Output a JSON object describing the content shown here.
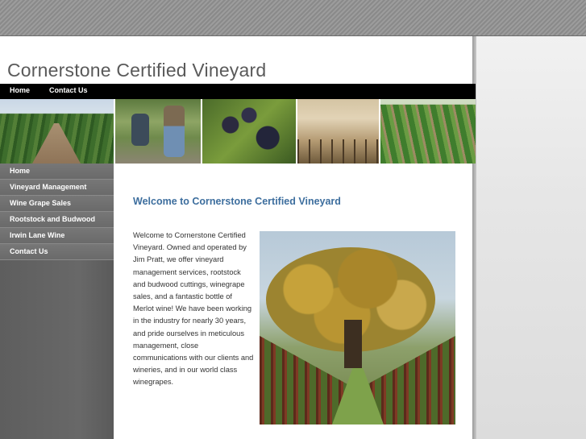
{
  "site": {
    "title": "Cornerstone Certified Vineyard"
  },
  "topnav": {
    "items": [
      {
        "label": "Home"
      },
      {
        "label": "Contact Us"
      }
    ]
  },
  "sidebar": {
    "items": [
      {
        "label": "Home"
      },
      {
        "label": "Vineyard Management"
      },
      {
        "label": "Wine Grape Sales"
      },
      {
        "label": "Rootstock and Budwood"
      },
      {
        "label": "Irwin Lane Wine"
      },
      {
        "label": "Contact Us"
      }
    ]
  },
  "main": {
    "heading": "Welcome to Cornerstone Certified Vineyard",
    "body": "Welcome to Cornerstone Certified Vineyard. Owned and operated by Jim Pratt, we offer vineyard management services, rootstock and budwood cuttings, winegrape sales, and a fantastic bottle of Merlot wine! We have been working in the industry for nearly 30 years, and pride ourselves in meticulous management, close communications with our clients and wineries, and in our world class winegrapes."
  },
  "colors": {
    "heading": "#3d6e9e",
    "nav_bg": "#000000",
    "sidebar_bg": "#666666"
  }
}
